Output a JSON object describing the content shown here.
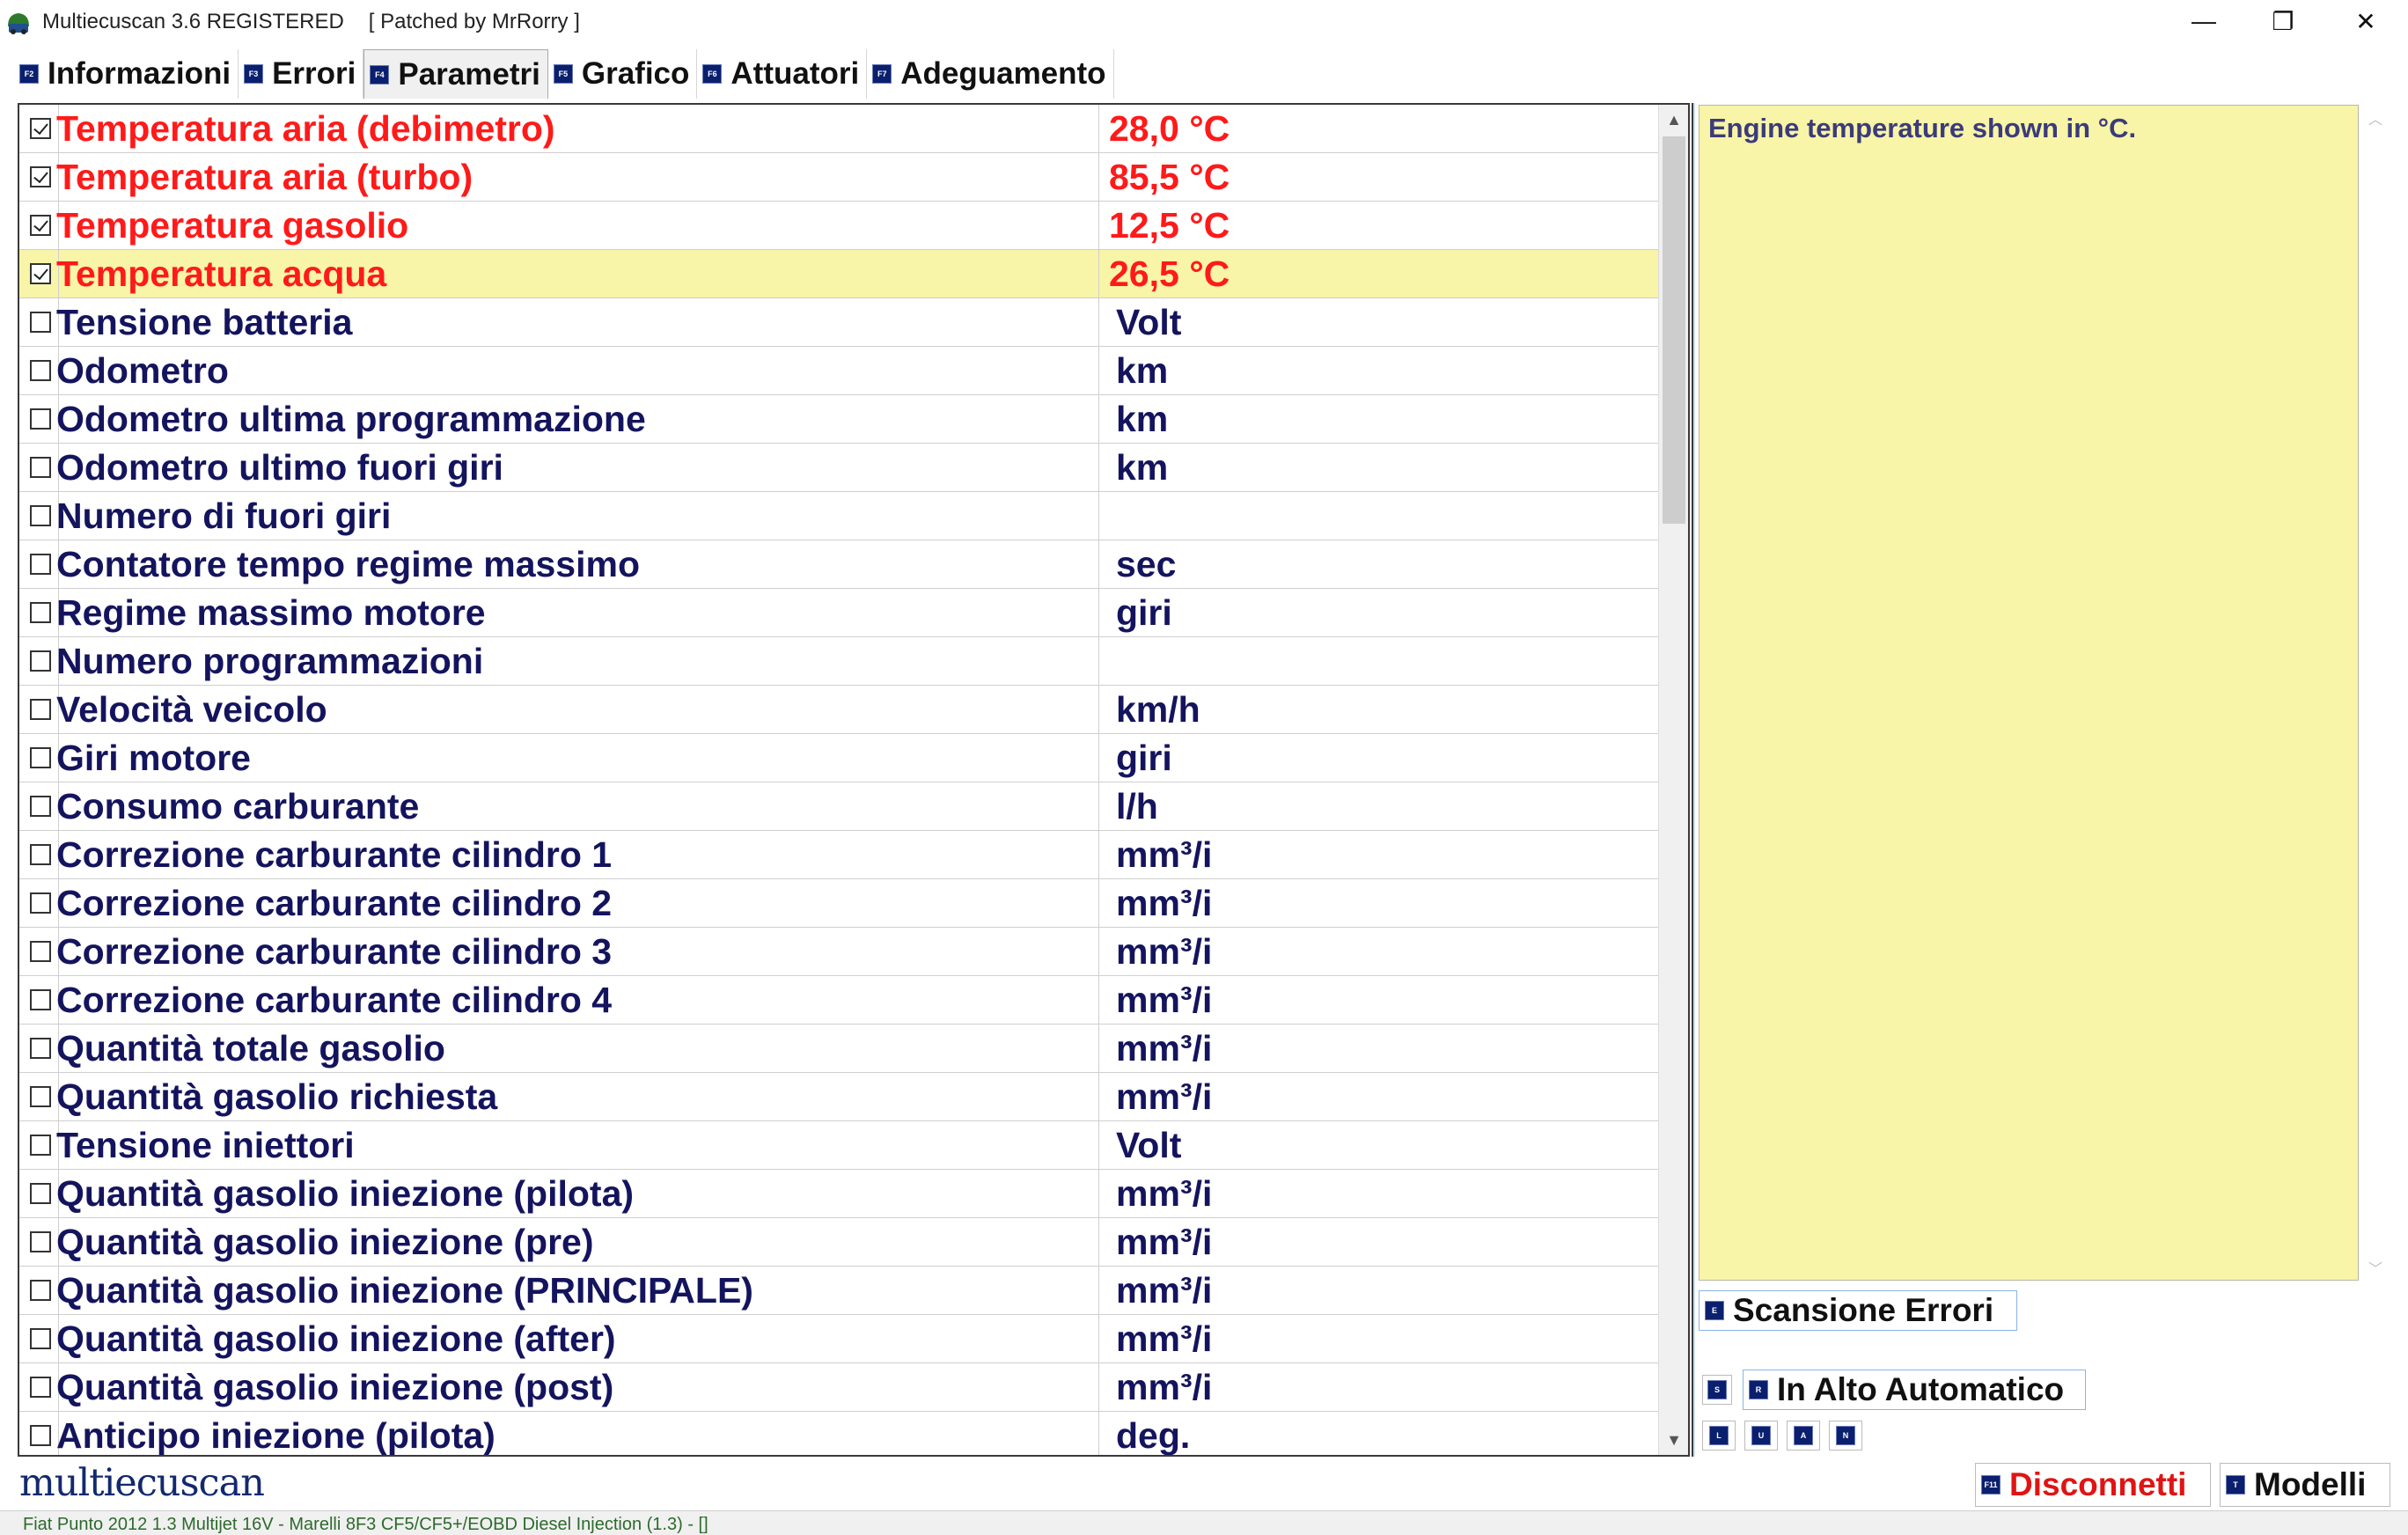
{
  "window": {
    "title": "Multiecuscan 3.6 REGISTERED",
    "patch": "[ Patched by MrRorry ]",
    "min_glyph": "—",
    "max_glyph": "❐",
    "close_glyph": "✕"
  },
  "tabs": [
    {
      "key": "F2",
      "label": "Informazioni",
      "active": false
    },
    {
      "key": "F3",
      "label": "Errori",
      "active": false
    },
    {
      "key": "F4",
      "label": "Parametri",
      "active": true
    },
    {
      "key": "F5",
      "label": "Grafico",
      "active": false
    },
    {
      "key": "F6",
      "label": "Attuatori",
      "active": false
    },
    {
      "key": "F7",
      "label": "Adeguamento",
      "active": false
    }
  ],
  "parameters": [
    {
      "name": "Temperatura aria (debimetro)",
      "value": "28,0 °C",
      "checked": true
    },
    {
      "name": "Temperatura aria (turbo)",
      "value": "85,5 °C",
      "checked": true
    },
    {
      "name": "Temperatura gasolio",
      "value": "12,5 °C",
      "checked": true
    },
    {
      "name": "Temperatura acqua",
      "value": "26,5 °C",
      "checked": true,
      "selected": true
    },
    {
      "name": "Tensione batteria",
      "value": "Volt",
      "checked": false
    },
    {
      "name": "Odometro",
      "value": "km",
      "checked": false
    },
    {
      "name": "Odometro ultima programmazione",
      "value": "km",
      "checked": false
    },
    {
      "name": "Odometro ultimo fuori giri",
      "value": "km",
      "checked": false
    },
    {
      "name": "Numero di fuori giri",
      "value": "",
      "checked": false
    },
    {
      "name": "Contatore tempo regime massimo",
      "value": "sec",
      "checked": false
    },
    {
      "name": "Regime massimo motore",
      "value": "giri",
      "checked": false
    },
    {
      "name": "Numero programmazioni",
      "value": "",
      "checked": false
    },
    {
      "name": "Velocità veicolo",
      "value": "km/h",
      "checked": false
    },
    {
      "name": "Giri motore",
      "value": "giri",
      "checked": false
    },
    {
      "name": "Consumo carburante",
      "value": "l/h",
      "checked": false
    },
    {
      "name": "Correzione carburante cilindro 1",
      "value": "mm³/i",
      "checked": false
    },
    {
      "name": "Correzione carburante cilindro 2",
      "value": "mm³/i",
      "checked": false
    },
    {
      "name": "Correzione carburante cilindro 3",
      "value": "mm³/i",
      "checked": false
    },
    {
      "name": "Correzione carburante cilindro 4",
      "value": "mm³/i",
      "checked": false
    },
    {
      "name": "Quantità totale gasolio",
      "value": "mm³/i",
      "checked": false
    },
    {
      "name": "Quantità gasolio richiesta",
      "value": "mm³/i",
      "checked": false
    },
    {
      "name": "Tensione iniettori",
      "value": "Volt",
      "checked": false
    },
    {
      "name": "Quantità gasolio iniezione (pilota)",
      "value": "mm³/i",
      "checked": false
    },
    {
      "name": "Quantità gasolio iniezione (pre)",
      "value": "mm³/i",
      "checked": false
    },
    {
      "name": "Quantità gasolio iniezione (PRINCIPALE)",
      "value": "mm³/i",
      "checked": false
    },
    {
      "name": "Quantità gasolio iniezione (after)",
      "value": "mm³/i",
      "checked": false
    },
    {
      "name": "Quantità gasolio iniezione (post)",
      "value": "mm³/i",
      "checked": false
    },
    {
      "name": "Anticipo iniezione (pilota)",
      "value": "deg.",
      "checked": false
    }
  ],
  "description": {
    "text": "Engine temperature shown in °C."
  },
  "buttons": {
    "scan": {
      "key": "E",
      "label": "Scansione Errori"
    },
    "s_key": "S",
    "auto": {
      "key": "R",
      "label": "In Alto Automatico"
    },
    "mini": [
      "L",
      "U",
      "A",
      "N"
    ],
    "disconnect": {
      "key": "F11",
      "label": "Disconnetti"
    },
    "models": {
      "key": "T",
      "label": "Modelli"
    }
  },
  "brand": "multiecuscan",
  "status": "Fiat Punto 2012 1.3 Multijet 16V - Marelli 8F3 CF5/CF5+/EOBD Diesel Injection (1.3) - []",
  "colors": {
    "active_param": "#ff1a1a",
    "inactive_param": "#14145e",
    "selected_row": "#f8f4a8",
    "fkey_badge": "#0a1f6e",
    "disconnect": "#e01414"
  }
}
